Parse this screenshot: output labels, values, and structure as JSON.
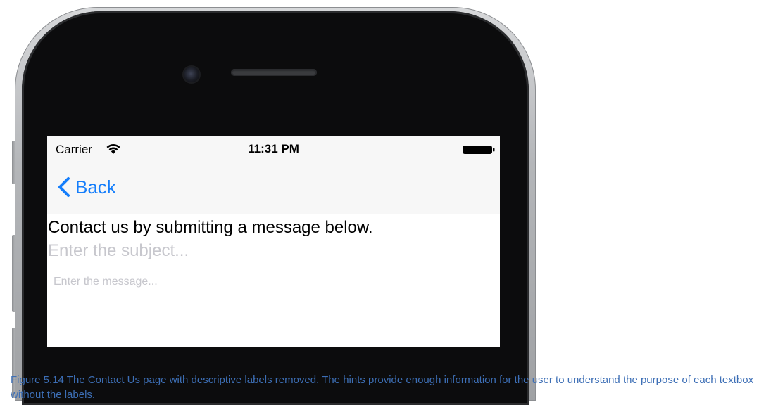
{
  "status_bar": {
    "carrier": "Carrier",
    "time": "11:31 PM",
    "icons": [
      "wifi-icon",
      "battery-icon"
    ]
  },
  "nav": {
    "back_label": "Back",
    "back_icon": "chevron-left-icon",
    "accent_color": "#157efb"
  },
  "content": {
    "title": "Contact us by submitting a message below.",
    "subject_placeholder": "Enter the subject...",
    "message_placeholder": "Enter the message..."
  },
  "caption": {
    "text": "Figure 5.14 The Contact Us page with descriptive labels removed. The hints provide enough information for the user to understand the purpose of each textbox without the labels.",
    "color": "#3d6fb6"
  },
  "device": {
    "hardware": [
      "camera-icon",
      "speaker-grille"
    ]
  }
}
